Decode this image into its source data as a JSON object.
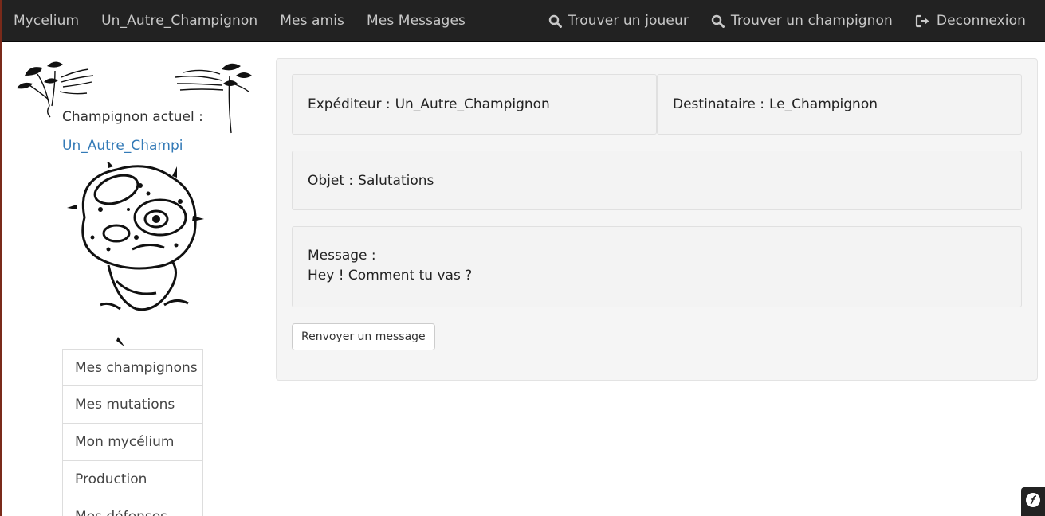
{
  "navbar": {
    "brand": "Mycelium",
    "left_links": [
      {
        "label": "Un_Autre_Champignon"
      },
      {
        "label": "Mes amis"
      },
      {
        "label": "Mes Messages"
      }
    ],
    "right_links": [
      {
        "label": "Trouver un joueur",
        "icon": "search-icon"
      },
      {
        "label": "Trouver un champignon",
        "icon": "search-icon"
      },
      {
        "label": "Deconnexion",
        "icon": "logout-icon"
      }
    ]
  },
  "sidebar": {
    "current_label": "Champignon actuel :",
    "current_name": "Un_Autre_Champi",
    "menu": [
      {
        "label": "Mes champignons"
      },
      {
        "label": "Mes mutations"
      },
      {
        "label": "Mon mycélium"
      },
      {
        "label": "Production"
      },
      {
        "label": "Mes défenses"
      }
    ]
  },
  "message": {
    "sender_label": "Expéditeur :",
    "sender": "Un_Autre_Champignon",
    "recipient_label": "Destinataire :",
    "recipient": "Le_Champignon",
    "subject_label": "Objet :",
    "subject": "Salutations",
    "body_label": "Message :",
    "body": "Hey ! Comment tu vas ?",
    "reply_button": "Renvoyer un message"
  },
  "colors": {
    "navbar_bg": "#222222",
    "nav_text": "#c8c8c8",
    "link": "#337ab7",
    "panel_bg": "#f5f5f5"
  }
}
